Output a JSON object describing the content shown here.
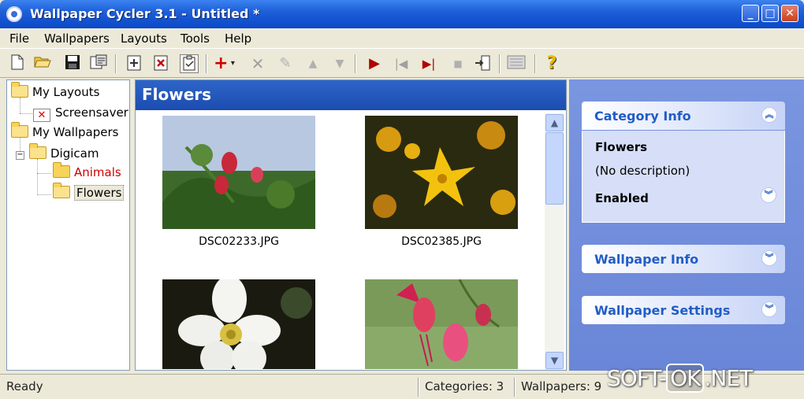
{
  "window": {
    "title": "Wallpaper Cycler 3.1 - Untitled *"
  },
  "menu": [
    {
      "label": "File"
    },
    {
      "label": "Wallpapers"
    },
    {
      "label": "Layouts"
    },
    {
      "label": "Tools"
    },
    {
      "label": "Help"
    }
  ],
  "tree": {
    "my_layouts": "My Layouts",
    "screensaver": "Screensaver",
    "my_wallpapers": "My Wallpapers",
    "digicam": "Digicam",
    "animals": "Animals",
    "flowers": "Flowers"
  },
  "main": {
    "header": "Flowers",
    "thumbnails": [
      {
        "name": "DSC02233.JPG"
      },
      {
        "name": "DSC02385.JPG"
      },
      {
        "name": ""
      },
      {
        "name": ""
      }
    ]
  },
  "panel": {
    "category_info": {
      "title": "Category Info",
      "name": "Flowers",
      "description": "(No description)",
      "status": "Enabled"
    },
    "wallpaper_info": {
      "title": "Wallpaper Info"
    },
    "wallpaper_settings": {
      "title": "Wallpaper Settings"
    }
  },
  "status": {
    "ready": "Ready",
    "categories": "Categories: 3",
    "wallpapers": "Wallpapers: 9"
  },
  "watermark": {
    "text_a": "SOFT-",
    "text_ok": "OK",
    "text_b": ".NET"
  },
  "colors": {
    "accent_red": "#cc0000",
    "header_blue": "#215dc6",
    "panel_blue": "#7a96e0"
  }
}
